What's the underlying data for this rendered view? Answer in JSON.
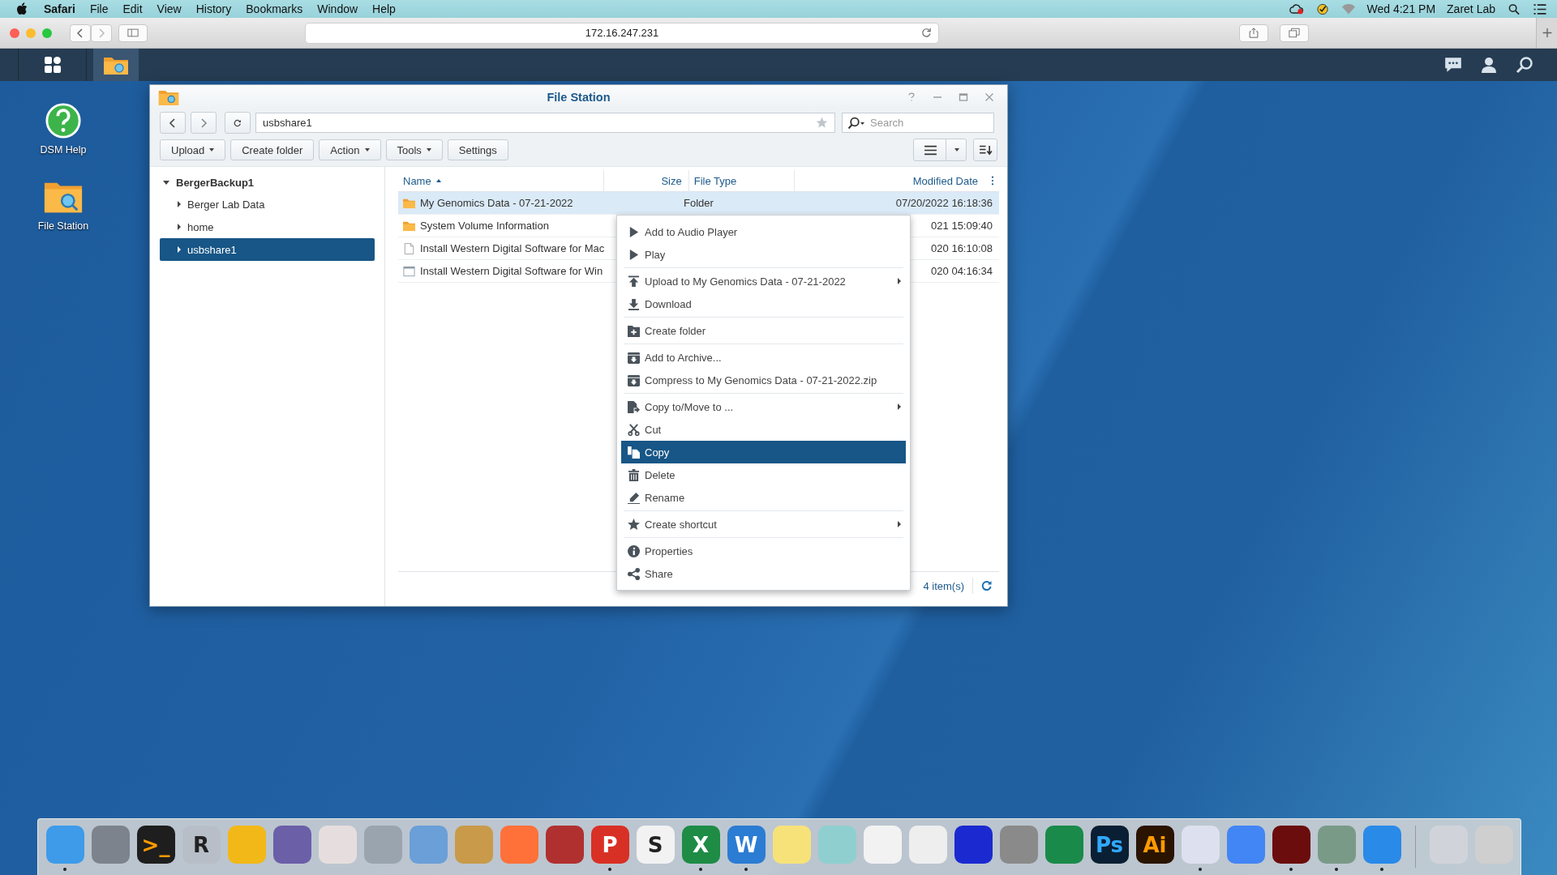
{
  "menubar": {
    "app": "Safari",
    "menus": [
      "File",
      "Edit",
      "View",
      "History",
      "Bookmarks",
      "Window",
      "Help"
    ],
    "clock": "Wed 4:21 PM",
    "user": "Zaret Lab"
  },
  "browser": {
    "url": "172.16.247.231"
  },
  "desktop_icons": [
    {
      "label": "DSM Help",
      "kind": "help"
    },
    {
      "label": "File Station",
      "kind": "folder"
    }
  ],
  "window": {
    "title": "File Station",
    "path": "usbshare1",
    "search": {
      "placeholder": "Search"
    },
    "toolbar": [
      {
        "label": "Upload",
        "dropdown": true
      },
      {
        "label": "Create folder",
        "dropdown": false
      },
      {
        "label": "Action",
        "dropdown": true
      },
      {
        "label": "Tools",
        "dropdown": true
      },
      {
        "label": "Settings",
        "dropdown": false
      }
    ],
    "tree": {
      "label": "BergerBackup1",
      "expanded": true,
      "children": [
        {
          "label": "Berger Lab Data",
          "selected": false
        },
        {
          "label": "home",
          "selected": false
        },
        {
          "label": "usbshare1",
          "selected": true
        }
      ]
    },
    "columns": [
      "Name",
      "Size",
      "File Type",
      "Modified Date"
    ],
    "rows": [
      {
        "name": "My Genomics Data - 07-21-2022",
        "type": "Folder",
        "modified": "07/20/2022 16:18:36",
        "kind": "folder",
        "selected": true
      },
      {
        "name": "System Volume Information",
        "modified": "021 15:09:40",
        "kind": "folder",
        "selected": false
      },
      {
        "name": "Install Western Digital Software for Mac",
        "modified": "020 16:10:08",
        "kind": "file",
        "selected": false
      },
      {
        "name": "Install Western Digital Software for Win",
        "modified": "020 04:16:34",
        "kind": "app",
        "selected": false
      }
    ],
    "status": "4 item(s)"
  },
  "context_menu": [
    [
      {
        "label": "Add to Audio Player",
        "kind": "play",
        "submenu": false,
        "selected": false
      },
      {
        "label": "Play",
        "kind": "play",
        "submenu": false,
        "selected": false
      }
    ],
    [
      {
        "label": "Upload to My Genomics Data - 07-21-2022",
        "kind": "upload",
        "submenu": true,
        "selected": false
      },
      {
        "label": "Download",
        "kind": "download",
        "submenu": false,
        "selected": false
      }
    ],
    [
      {
        "label": "Create folder",
        "kind": "folder-plus",
        "submenu": false,
        "selected": false
      }
    ],
    [
      {
        "label": "Add to Archive...",
        "kind": "archive",
        "submenu": false,
        "selected": false
      },
      {
        "label": "Compress to My Genomics Data - 07-21-2022.zip",
        "kind": "archive",
        "submenu": false,
        "selected": false
      }
    ],
    [
      {
        "label": "Copy to/Move to ...",
        "kind": "move",
        "submenu": true,
        "selected": false
      },
      {
        "label": "Cut",
        "kind": "cut",
        "submenu": false,
        "selected": false
      },
      {
        "label": "Copy",
        "kind": "copy",
        "submenu": false,
        "selected": true
      },
      {
        "label": "Delete",
        "kind": "delete",
        "submenu": false,
        "selected": false
      },
      {
        "label": "Rename",
        "kind": "rename",
        "submenu": false,
        "selected": false
      }
    ],
    [
      {
        "label": "Create shortcut",
        "kind": "star",
        "submenu": true,
        "selected": false
      }
    ],
    [
      {
        "label": "Properties",
        "kind": "info",
        "submenu": false,
        "selected": false
      },
      {
        "label": "Share",
        "kind": "share",
        "submenu": false,
        "selected": false
      }
    ]
  ],
  "dock": [
    {
      "color": "#3d9be9",
      "running": true
    },
    {
      "color": "#7d838c",
      "running": false
    },
    {
      "color": "#1e1e1e",
      "glyph": ">_",
      "running": false
    },
    {
      "color": "#b8bec8",
      "glyph": "R",
      "running": false
    },
    {
      "color": "#f2b818",
      "running": false
    },
    {
      "color": "#6b5fa8",
      "running": false
    },
    {
      "color": "#e6dede",
      "running": false
    },
    {
      "color": "#9aa4ae",
      "running": false
    },
    {
      "color": "#6a9fd8",
      "running": false
    },
    {
      "color": "#c89a4a",
      "running": false
    },
    {
      "color": "#ff7139",
      "running": false
    },
    {
      "color": "#b03030",
      "running": false
    },
    {
      "color": "#d93025",
      "glyph": "P",
      "running": true
    },
    {
      "color": "#f2f2f2",
      "glyph": "S",
      "running": false
    },
    {
      "color": "#1e8c45",
      "glyph": "X",
      "running": true
    },
    {
      "color": "#2b7cd3",
      "glyph": "W",
      "running": true
    },
    {
      "color": "#f7e27a",
      "running": false
    },
    {
      "color": "#8fcfcf",
      "running": false
    },
    {
      "color": "#f2f2f2",
      "running": false
    },
    {
      "color": "#eeeeee",
      "running": false
    },
    {
      "color": "#1a2ad0",
      "running": false
    },
    {
      "color": "#8a8a8a",
      "running": false
    },
    {
      "color": "#1a8a4a",
      "running": false
    },
    {
      "color": "#0a1f33",
      "glyph": "Ps",
      "running": false
    },
    {
      "color": "#2a1400",
      "glyph": "Ai",
      "running": false
    },
    {
      "color": "#dde0ee",
      "running": true
    },
    {
      "color": "#4285f4",
      "running": false
    },
    {
      "color": "#6b0d0d",
      "running": true
    },
    {
      "color": "#7a9a88",
      "running": true
    },
    {
      "color": "#2a8ae8",
      "running": true
    },
    {
      "color": "#d0d4da",
      "running": false
    },
    {
      "color": "#cfcfcf",
      "running": false
    }
  ]
}
